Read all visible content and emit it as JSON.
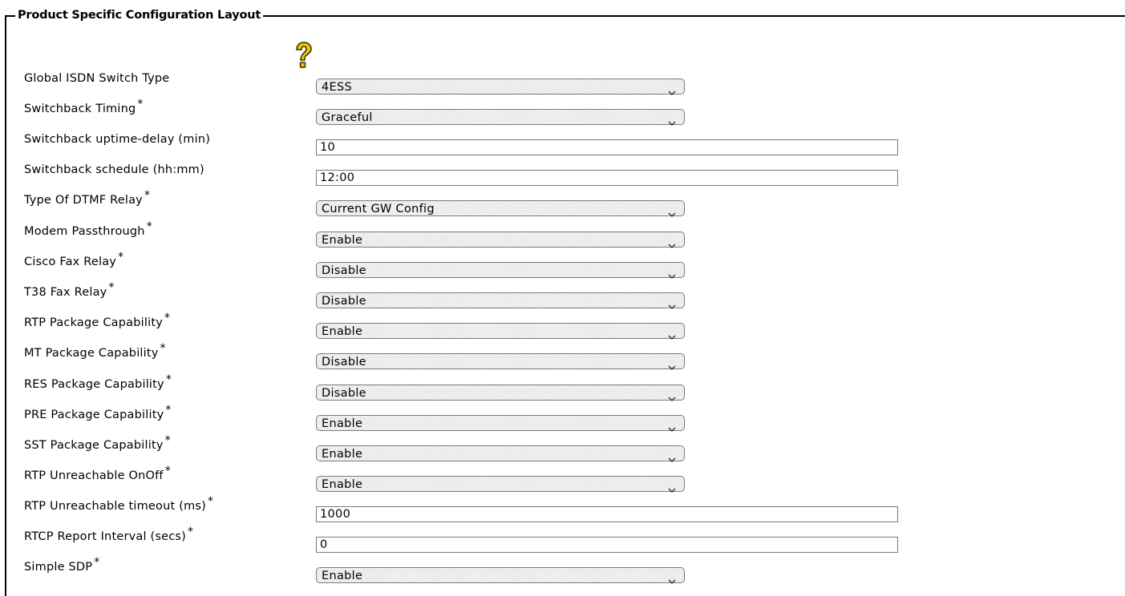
{
  "section": {
    "title": "Product Specific Configuration Layout"
  },
  "icons": {
    "help": "help-question-icon",
    "dropdown": "chevron-down-icon"
  },
  "fields": [
    {
      "label": "Global ISDN Switch Type",
      "required": false,
      "type": "select",
      "value": "4ESS"
    },
    {
      "label": "Switchback Timing",
      "required": true,
      "type": "select",
      "value": "Graceful"
    },
    {
      "label": "Switchback uptime-delay (min)",
      "required": false,
      "type": "text",
      "value": "10"
    },
    {
      "label": "Switchback schedule (hh:mm)",
      "required": false,
      "type": "text",
      "value": "12:00"
    },
    {
      "label": "Type Of DTMF Relay",
      "required": true,
      "type": "select",
      "value": "Current GW Config"
    },
    {
      "label": "Modem Passthrough",
      "required": true,
      "type": "select",
      "value": "Enable"
    },
    {
      "label": "Cisco Fax Relay",
      "required": true,
      "type": "select",
      "value": "Disable"
    },
    {
      "label": "T38 Fax Relay",
      "required": true,
      "type": "select",
      "value": "Disable"
    },
    {
      "label": "RTP Package Capability",
      "required": true,
      "type": "select",
      "value": "Enable"
    },
    {
      "label": "MT Package Capability",
      "required": true,
      "type": "select",
      "value": "Disable"
    },
    {
      "label": "RES Package Capability",
      "required": true,
      "type": "select",
      "value": "Disable"
    },
    {
      "label": "PRE Package Capability",
      "required": true,
      "type": "select",
      "value": "Enable"
    },
    {
      "label": "SST Package Capability",
      "required": true,
      "type": "select",
      "value": "Enable"
    },
    {
      "label": "RTP Unreachable OnOff",
      "required": true,
      "type": "select",
      "value": "Enable"
    },
    {
      "label": "RTP Unreachable timeout (ms)",
      "required": true,
      "type": "text",
      "value": "1000"
    },
    {
      "label": "RTCP Report Interval (secs)",
      "required": true,
      "type": "text",
      "value": "0"
    },
    {
      "label": "Simple SDP",
      "required": true,
      "type": "select",
      "value": "Enable"
    }
  ]
}
